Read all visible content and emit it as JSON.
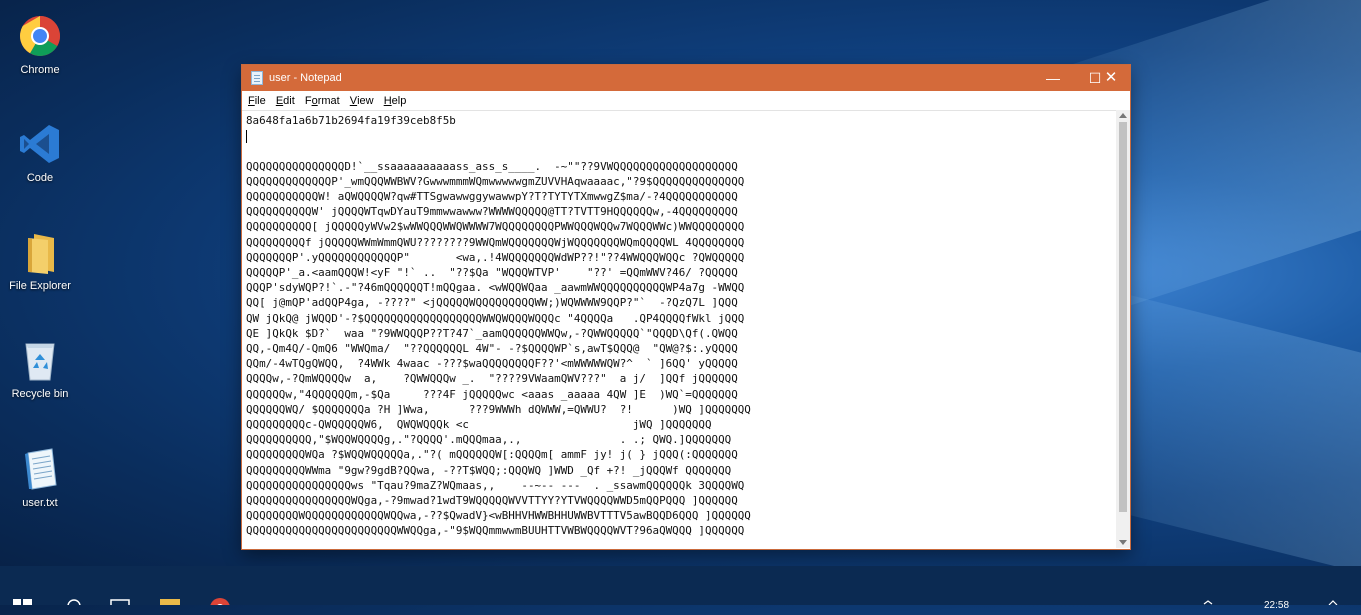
{
  "desktop": {
    "icons": [
      {
        "label": "Chrome",
        "icon": "chrome-icon"
      },
      {
        "label": "Code",
        "icon": "vscode-icon"
      },
      {
        "label": "File Explorer",
        "icon": "folder-icon"
      },
      {
        "label": "Recycle bin",
        "icon": "recycle-bin-icon"
      },
      {
        "label": "user.txt",
        "icon": "text-file-icon"
      }
    ]
  },
  "window": {
    "title": "user - Notepad",
    "controls": {
      "minimize": "—",
      "maximize": "☐",
      "close": "✕"
    },
    "menu": {
      "file": {
        "accel": "F",
        "rest": "ile"
      },
      "edit": {
        "accel": "E",
        "rest": "dit"
      },
      "format": {
        "pre": "F",
        "accel": "o",
        "rest": "rmat"
      },
      "view": {
        "accel": "V",
        "rest": "iew"
      },
      "help": {
        "accel": "H",
        "rest": "elp"
      }
    },
    "hash_line": "8a648fa1a6b71b2694fa19f39ceb8f5b",
    "ascii_art": "QQQQQQQQQQQQQQQD!`__ssaaaaaaaaaass_ass_s____.  -~\"\"??9VWQQQQQQQQQQQQQQQQQQQ\nQQQQQQQQQQQQQP'_wmQQQWWBWV?GwwwmmmWQmwwwwwgmZUVVHAqwaaaac,\"?9$QQQQQQQQQQQQQQ\nQQQQQQQQQQQW! aQWQQQQW?qw#TTSgwawwggywawwpY?T?TYTYTXmwwgZ$ma/-?4QQQQQQQQQQQ\nQQQQQQQQQQW' jQQQQWTqwDYauT9mmwwawww?WWWWQQQQQ@TT?TVTT9HQQQQQQw,-4QQQQQQQQQ\nQQQQQQQQQQ[ jQQQQQyWVw2$wWWQQQWWQWWWW7WQQQQQQQQPWWQQQWQQw7WQQQWWc)WWQQQQQQQQ\nQQQQQQQQQf jQQQQQWWmWmmQWU????????9WWQmWQQQQQQQWjWQQQQQQQWQmQQQQWL 4QQQQQQQQ\nQQQQQQQP'.yQQQQQQQQQQQQP\"       <wa,.!4WQQQQQQQWdWP??!\"??4WWQQQWQQc ?QWQQQQQ\nQQQQQP'_a.<aamQQQW!<yF \"!` ..  \"??$Qa \"WQQQWTVP'    \"??' =QQmWWV?46/ ?QQQQQ\nQQQP'sdyWQP?!`.-\"?46mQQQQQQT!mQQgaa. <wWQQWQaa _aawmWWQQQQQQQQQQWP4a7g -WWQQ\nQQ[ j@mQP'adQQP4ga, -????\" <jQQQQQWQQQQQQQQQWW;)WQWWWW9QQP?\"`  -?QzQ7L ]QQQ\nQW jQkQ@ jWQQD'-?$QQQQQQQQQQQQQQQQQQWWQWQQQWQQQc \"4QQQQa   .QP4QQQQfWkl jQQQ\nQE ]QkQk $D?`  waa \"?9WWQQQP??T?47`_aamQQQQQQWWQw,-?QWWQQQQQ`\"QQQD\\Qf(.QWQQ\nQQ,-Qm4Q/-QmQ6 \"WWQma/  \"??QQQQQQL 4W\"- -?$QQQQWP`s,awT$QQQ@  \"QW@?$:.yQQQQ\nQQm/-4wTQgQWQQ,  ?4WWk 4waac -???$waQQQQQQQQF??'<mWWWWWQW?^  ` ]6QQ' yQQQQQ\nQQQQw,-?QmWQQQQw  a,    ?QWWQQQw _.  \"????9VWaamQWV???\"  a j/  ]QQf jQQQQQQ\nQQQQQQw,\"4QQQQQQm,-$Qa     ???4F jQQQQQwc <aaas _aaaaa 4QW ]E  )WQ`=QQQQQQQ\nQQQQQQWQ/ $QQQQQQQa ?H ]Wwa,      ???9WWWh dQWWW,=QWWU?  ?!      )WQ ]QQQQQQQ\nQQQQQQQQQc-QWQQQQQW6,  QWQWQQQk <c                         jWQ ]QQQQQQQ\nQQQQQQQQQQ,\"$WQQWQQQQg,.\"?QQQQ'.mQQQmaa,.,               . .; QWQ.]QQQQQQQ\nQQQQQQQQQWQa ?$WQQWQQQQQa,.\"?( mQQQQQQW[:QQQQm[ ammF jy! j( } jQQQ(:QQQQQQQ\nQQQQQQQQQWWma \"9gw?9gdB?QQwa, -??T$WQQ;:QQQWQ ]WWD _Qf +?! _jQQQWf QQQQQQQ\nQQQQQQQQQQQQQQQQws \"Tqau?9maZ?WQmaas,,    --~-- ---  . _ssawmQQQQQQk 3QQQQWQ\nQQQQQQQQQQQQQQQQWQga,-?9mwad?1wdT9WQQQQQWVVTTYY?YTVWQQQQWWD5mQQPQQQ ]QQQQQQ\nQQQQQQQQWQQQQQQQQQQQQWQQwa,-??$QwadV}<wBHHVHWWBHHUWWBVTTTV5awBQQD6QQQ ]QQQQQQ\nQQQQQQQQQQQQQQQQQQQQQQQWWQQga,-\"9$WQQmmwwmBUUHTTVWBWQQQQWVT?96aQWQQQ ]QQQQQQ"
  },
  "taskbar": {
    "clock": "22:58"
  }
}
